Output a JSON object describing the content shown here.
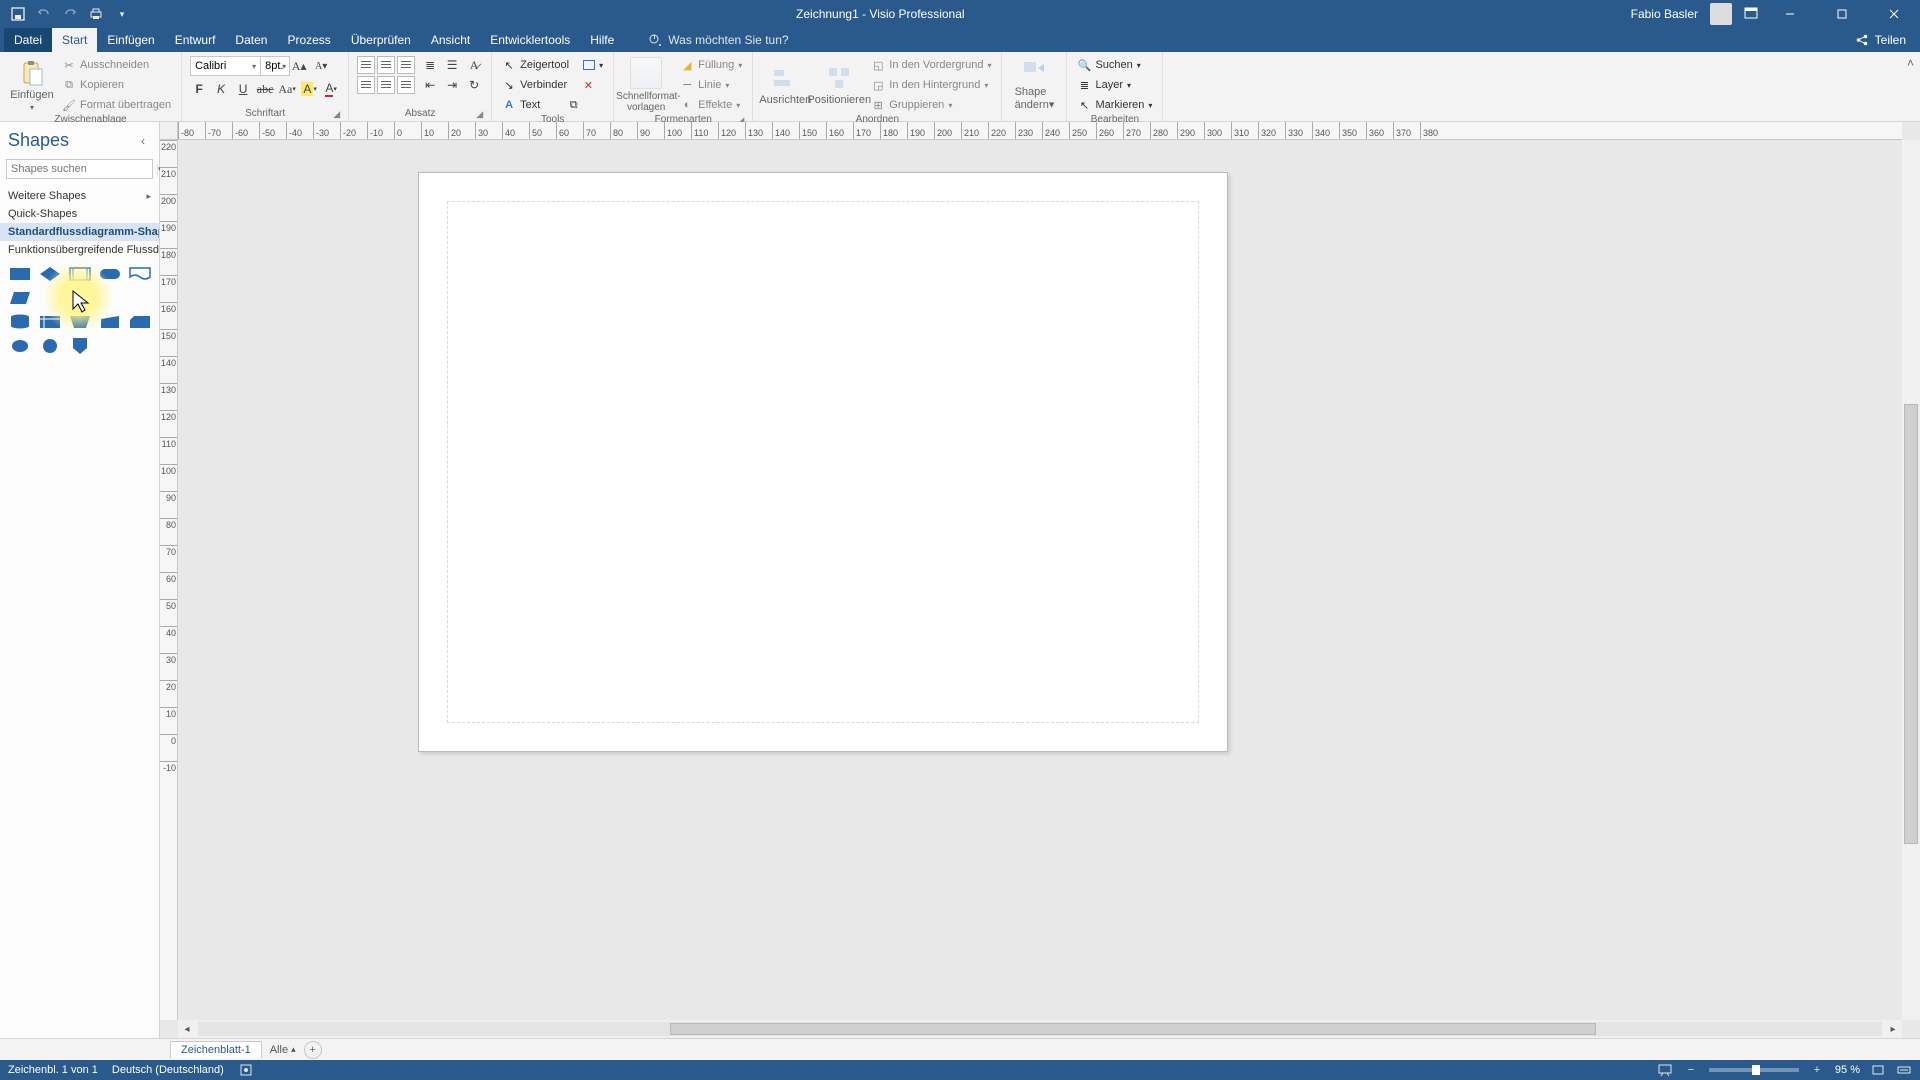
{
  "titlebar": {
    "doc_title": "Zeichnung1  -  Visio Professional",
    "user_name": "Fabio Basler"
  },
  "menu": {
    "file": "Datei",
    "tabs": [
      "Start",
      "Einfügen",
      "Entwurf",
      "Daten",
      "Prozess",
      "Überprüfen",
      "Ansicht",
      "Entwicklertools",
      "Hilfe"
    ],
    "active_index": 0,
    "tell_me": "Was möchten Sie tun?",
    "share": "Teilen"
  },
  "ribbon": {
    "clipboard": {
      "paste": "Einfügen",
      "cut": "Ausschneiden",
      "copy": "Kopieren",
      "format_painter": "Format übertragen",
      "label": "Zwischenablage"
    },
    "font": {
      "name": "Calibri",
      "size": "8pt.",
      "label": "Schriftart"
    },
    "paragraph": {
      "label": "Absatz"
    },
    "tools": {
      "pointer": "Zeigertool",
      "connector": "Verbinder",
      "text": "Text",
      "label": "Tools"
    },
    "shape_styles": {
      "quick": "Schnellformat-vorlagen",
      "fill": "Füllung",
      "line": "Linie",
      "effects": "Effekte",
      "label": "Formenarten"
    },
    "arrange": {
      "align": "Ausrichten",
      "position": "Positionieren",
      "front": "In den Vordergrund",
      "back": "In den Hintergrund",
      "group": "Gruppieren",
      "label": "Anordnen"
    },
    "change_shape": {
      "label_top": "Shape",
      "label_bottom": "ändern"
    },
    "editing": {
      "find": "Suchen",
      "layer": "Layer",
      "select": "Markieren",
      "label": "Bearbeiten"
    }
  },
  "shapes_panel": {
    "title": "Shapes",
    "search_placeholder": "Shapes suchen",
    "more_shapes": "Weitere Shapes",
    "stencils": [
      "Quick-Shapes",
      "Standardflussdiagramm-Shapes",
      "Funktionsübergreifende Flussdiagra..."
    ],
    "selected_stencil_index": 1
  },
  "ruler": {
    "h_start": -80,
    "h_step": 10,
    "h_count": 47,
    "v_start": 220,
    "v_step": -10,
    "v_count": 24
  },
  "page_tabs": {
    "page1": "Zeichenblatt-1",
    "all": "Alle"
  },
  "status": {
    "page_info": "Zeichenbl. 1 von 1",
    "language": "Deutsch (Deutschland)",
    "zoom": "95 %"
  }
}
